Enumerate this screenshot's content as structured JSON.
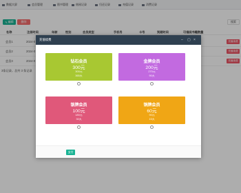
{
  "nav": {
    "items": [
      "数据大屏",
      "会员管理",
      "图书管理",
      "借阅记录",
      "归还记录",
      "充值记录",
      "消费记录"
    ]
  },
  "toolbar": {
    "edit_label": "编辑",
    "delete_label": "删除",
    "search_label": "搜索"
  },
  "table": {
    "columns": [
      "名称",
      "注册时间",
      "年龄",
      "性别",
      "会员类型",
      "手机号",
      "卡号",
      "到期时间",
      "可借阅书籍数量"
    ],
    "rows": [
      {
        "name": "会员1",
        "date": "2024-0"
      },
      {
        "name": "会员2",
        "date": "2024-0"
      },
      {
        "name": "会员3",
        "date": "2024-0"
      }
    ],
    "row_action": "充值续费",
    "footer": "3条记录，总共 3 条记录"
  },
  "modal": {
    "title": "充值续费",
    "controls": [
      "–",
      "▢",
      "×"
    ],
    "plans": [
      {
        "name": "钻石会员",
        "price": "300元",
        "credit": "300元",
        "days": "365天",
        "color": "#a8c832"
      },
      {
        "name": "金牌会员",
        "price": "200元",
        "credit": "270元",
        "days": "90天",
        "color": "#c26ae0"
      },
      {
        "name": "银牌会员",
        "price": "100元",
        "credit": "180元",
        "days": "30天",
        "color": "#e0587a"
      },
      {
        "name": "铜牌会员",
        "price": "60元",
        "credit": "90元",
        "days": "15天",
        "color": "#f0a615"
      }
    ],
    "pay_label": "支付"
  }
}
